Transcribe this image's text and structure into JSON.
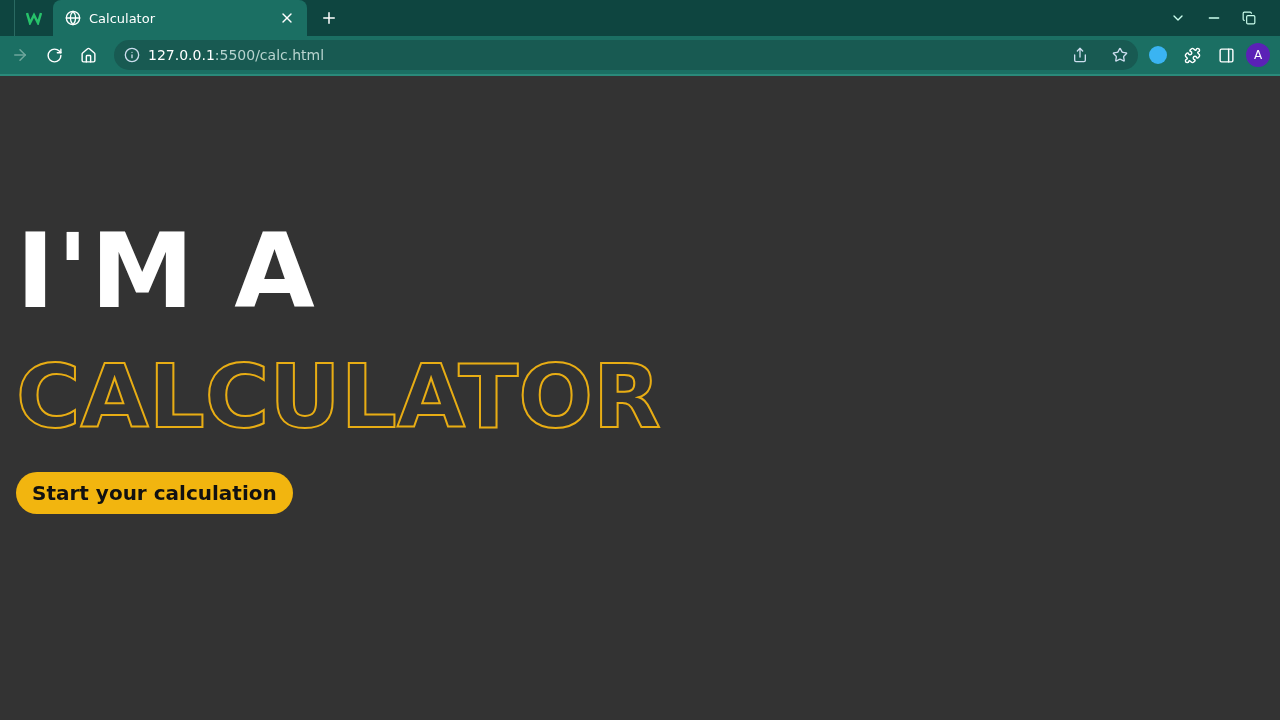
{
  "browser": {
    "tab_title": "Calculator",
    "url_host": "127.0.0.1",
    "url_path": ":5500/calc.html",
    "profile_initial": "A"
  },
  "hero": {
    "line_1": "I'M A",
    "line_2": "CALCULATOR",
    "button": "Start your calculation"
  }
}
